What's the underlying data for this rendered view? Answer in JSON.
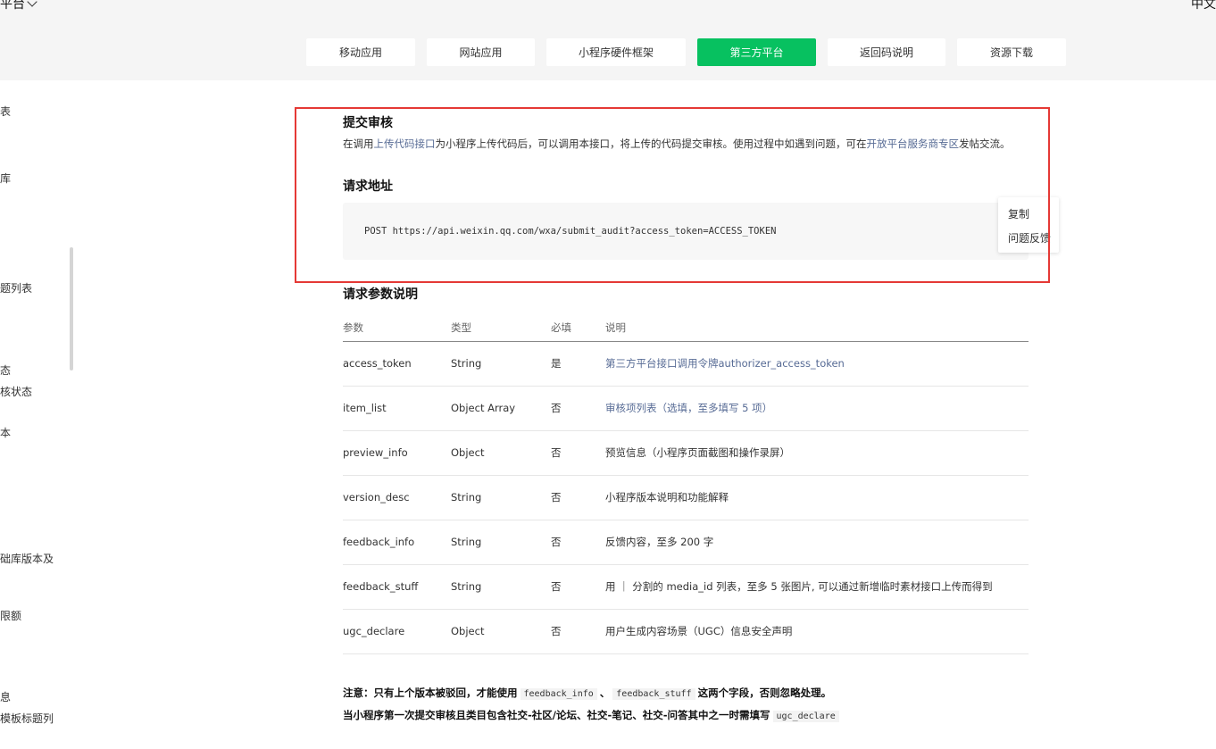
{
  "header": {
    "platform_menu": "平台",
    "lang_menu": "中文"
  },
  "tabs": [
    {
      "label": "移动应用",
      "active": false
    },
    {
      "label": "网站应用",
      "active": false
    },
    {
      "label": "小程序硬件框架",
      "active": false
    },
    {
      "label": "第三方平台",
      "active": true
    },
    {
      "label": "返回码说明",
      "active": false
    },
    {
      "label": "资源下载",
      "active": false
    }
  ],
  "sidebar": {
    "items": [
      "表",
      "库",
      "题列表",
      "态",
      "核状态",
      "本",
      "础库版本及",
      "限额",
      "息",
      "模板标题列"
    ]
  },
  "section": {
    "title": "提交审核",
    "desc_prefix": "在调用",
    "desc_link1": "上传代码接口",
    "desc_mid": "为小程序上传代码后，可以调用本接口，将上传的代码提交审核。使用过程中如遇到问题，可在",
    "desc_link2": "开放平台服务商专区",
    "desc_suffix": "发帖交流。"
  },
  "request_url": {
    "title": "请求地址",
    "code": "POST https://api.weixin.qq.com/wxa/submit_audit?access_token=ACCESS_TOKEN",
    "menu": [
      "复制",
      "问题反馈"
    ]
  },
  "params": {
    "title": "请求参数说明",
    "headers": [
      "参数",
      "类型",
      "必填",
      "说明"
    ],
    "rows": [
      {
        "name": "access_token",
        "type": "String",
        "required": "是",
        "desc": "第三方平台接口调用令牌authorizer_access_token",
        "desc_link": true
      },
      {
        "name": "item_list",
        "type": "Object Array",
        "required": "否",
        "desc": "审核项列表（选填，至多填写 5 项）",
        "desc_link": true
      },
      {
        "name": "preview_info",
        "type": "Object",
        "required": "否",
        "desc": "预览信息（小程序页面截图和操作录屏）",
        "desc_link": false
      },
      {
        "name": "version_desc",
        "type": "String",
        "required": "否",
        "desc": "小程序版本说明和功能解释",
        "desc_link": false
      },
      {
        "name": "feedback_info",
        "type": "String",
        "required": "否",
        "desc": "反馈内容，至多 200 字",
        "desc_link": false
      },
      {
        "name": "feedback_stuff",
        "type": "String",
        "required": "否",
        "desc": "用 ｜ 分割的 media_id 列表，至多 5 张图片, 可以通过新增临时素材接口上传而得到",
        "desc_link": false
      },
      {
        "name": "ugc_declare",
        "type": "Object",
        "required": "否",
        "desc": "用户生成内容场景（UGC）信息安全声明",
        "desc_link": false
      }
    ]
  },
  "notes": {
    "note1_prefix": "注意：只有上个版本被驳回，才能使用",
    "note1_code1": "feedback_info",
    "note1_sep": "、",
    "note1_code2": "feedback_stuff",
    "note1_suffix": "这两个字段，否则忽略处理。",
    "note2_prefix": "当小程序第一次提交审核且类目包含社交-社区/论坛、社交-笔记、社交-问答其中之一时需填写",
    "note2_code": "ugc_declare"
  },
  "colors": {
    "accent": "#07c160",
    "link": "#576b95",
    "highlight_border": "#e53935"
  }
}
